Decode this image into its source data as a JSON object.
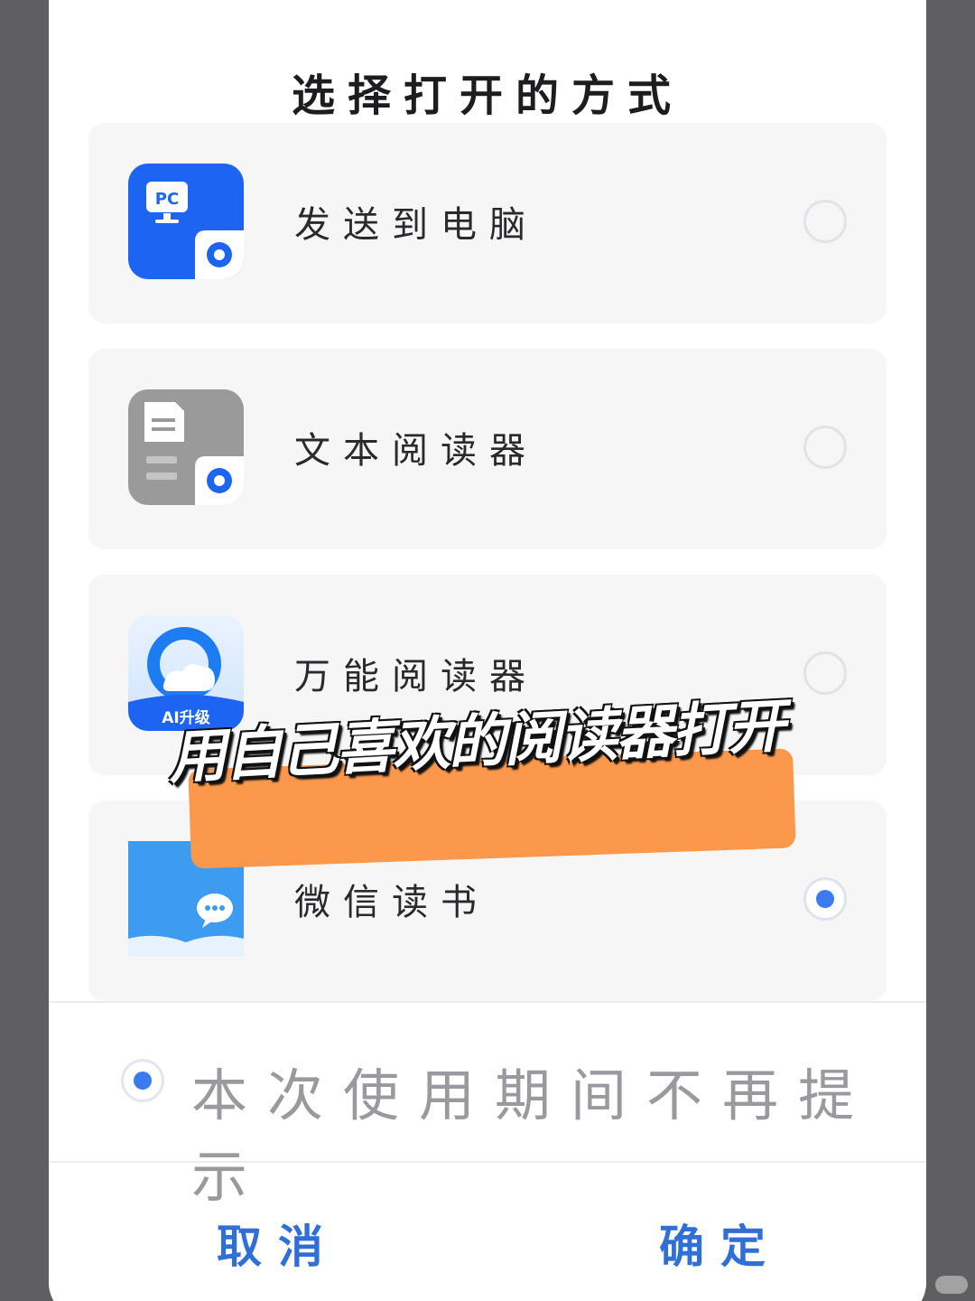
{
  "dialog": {
    "title": "选择打开的方式",
    "options": [
      {
        "label": "发送到电脑",
        "icon": "pc-transfer-icon",
        "selected": false
      },
      {
        "label": "文本阅读器",
        "icon": "text-reader-icon",
        "selected": false
      },
      {
        "label": "万能阅读器",
        "icon": "universal-reader-icon",
        "badge": "AI升级",
        "selected": false
      },
      {
        "label": "微信读书",
        "icon": "wechat-read-icon",
        "selected": true
      }
    ],
    "remember": {
      "label": "本次使用期间不再提示",
      "checked": true
    },
    "cancel_label": "取消",
    "confirm_label": "确定"
  },
  "overlay": {
    "caption": "用自己喜欢的阅读器打开",
    "highlight_color": "#fb984c"
  },
  "icons": {
    "pc_label": "PC"
  },
  "colors": {
    "accent": "#3b7bf1",
    "button_text": "#2f6fd6",
    "pc_icon_bg": "#1d64f2",
    "text_reader_bg": "#9a9a9a",
    "wechat_read_bg": "#3d9bf0"
  }
}
